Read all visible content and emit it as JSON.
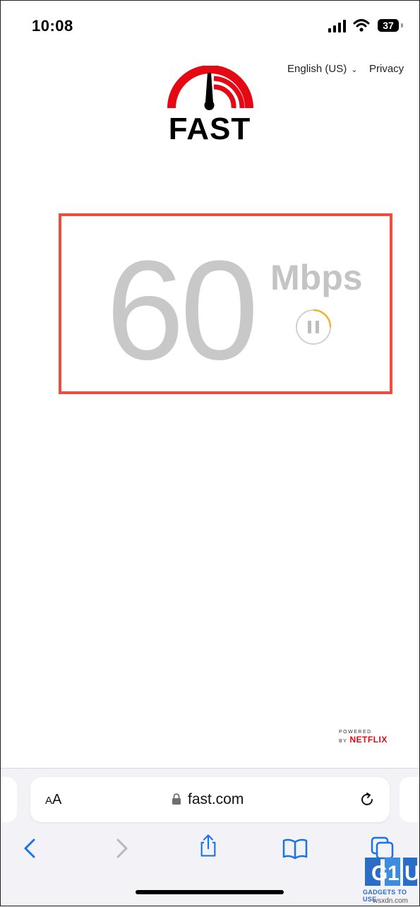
{
  "status_bar": {
    "time": "10:08",
    "battery": "37"
  },
  "header": {
    "language": "English (US)",
    "language_caret": "⌄",
    "privacy": "Privacy"
  },
  "logo": {
    "text": "FAST",
    "brand_color": "#e50914"
  },
  "speed": {
    "value": "60",
    "units": "Mbps",
    "highlight_color": "#ef4d3e",
    "progress_color": "#f0b429"
  },
  "footer": {
    "powered_by": "POWERED BY",
    "netflix": "NETFLIX"
  },
  "browser": {
    "text_size_label_big": "A",
    "text_size_label_small": "A",
    "url": "fast.com",
    "icons": {
      "back": "chevron-left-icon",
      "forward": "chevron-right-icon",
      "share": "share-icon",
      "bookmarks": "book-icon",
      "tabs": "tabs-icon",
      "reload": "reload-icon",
      "lock": "lock-icon"
    },
    "accent": "#1a73e8"
  },
  "watermark": {
    "text": "GADGETS TO USE",
    "site": "wsxdn.com"
  }
}
